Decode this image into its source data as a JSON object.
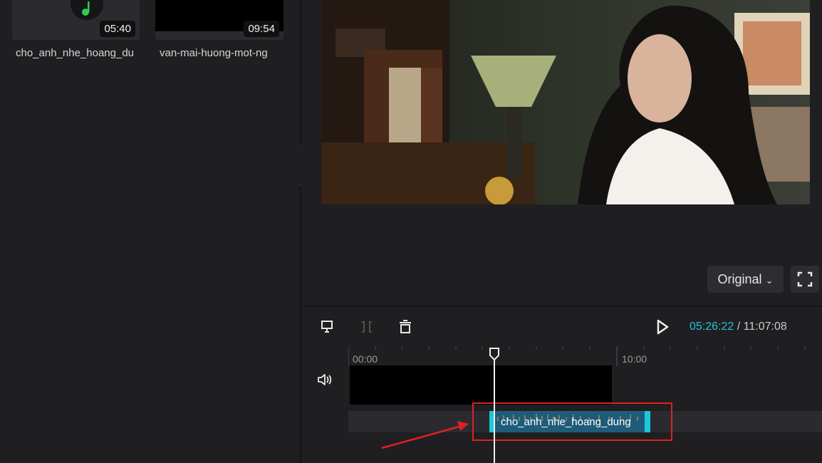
{
  "media": {
    "items": [
      {
        "title": "cho_anh_nhe_hoang_du",
        "duration": "05:40",
        "type": "audio"
      },
      {
        "title": "van-mai-huong-mot-ng",
        "duration": "09:54",
        "type": "video"
      }
    ]
  },
  "player": {
    "ratio_label": "Original",
    "fullscreen_icon": "fullscreen-icon"
  },
  "toolbar": {
    "current_time": "05:26:22",
    "separator": "/",
    "total_time": "11:07:08"
  },
  "timeline": {
    "ruler_labels": [
      "00:00",
      "10:00"
    ],
    "audio_clip_label": "cho_anh_nhe_hoang_dung",
    "highlight_color": "#e02020",
    "accent_color": "#22c3d8"
  }
}
